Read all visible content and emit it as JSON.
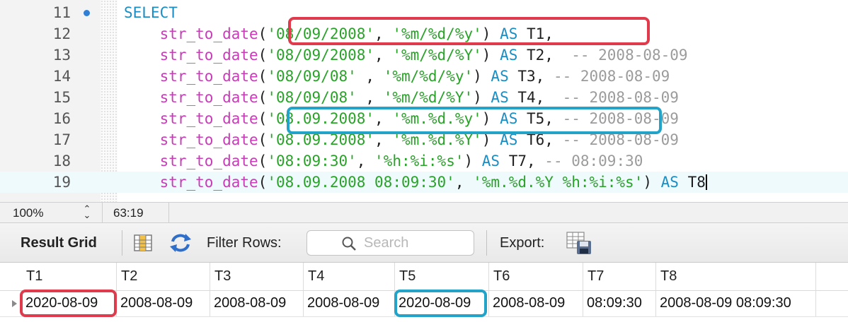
{
  "editor": {
    "lines": [
      {
        "num": "11",
        "breakpoint": true,
        "current": false,
        "tokens": [
          {
            "t": "SELECT",
            "c": "kw"
          }
        ]
      },
      {
        "num": "12",
        "current": false,
        "tokens": [
          {
            "t": "    str_to_date",
            "c": "fn"
          },
          {
            "t": "(",
            "c": "pn"
          },
          {
            "t": "'08/09/2008'",
            "c": "str"
          },
          {
            "t": ", ",
            "c": "pn"
          },
          {
            "t": "'%m/%d/%y'",
            "c": "str"
          },
          {
            "t": ") ",
            "c": "pn"
          },
          {
            "t": "AS",
            "c": "kw"
          },
          {
            "t": " T1,",
            "c": "id"
          }
        ]
      },
      {
        "num": "13",
        "current": false,
        "tokens": [
          {
            "t": "    str_to_date",
            "c": "fn"
          },
          {
            "t": "(",
            "c": "pn"
          },
          {
            "t": "'08/09/2008'",
            "c": "str"
          },
          {
            "t": ", ",
            "c": "pn"
          },
          {
            "t": "'%m/%d/%Y'",
            "c": "str"
          },
          {
            "t": ") ",
            "c": "pn"
          },
          {
            "t": "AS",
            "c": "kw"
          },
          {
            "t": " T2,  ",
            "c": "id"
          },
          {
            "t": "-- 2008-08-09",
            "c": "cm"
          }
        ]
      },
      {
        "num": "14",
        "current": false,
        "tokens": [
          {
            "t": "    str_to_date",
            "c": "fn"
          },
          {
            "t": "(",
            "c": "pn"
          },
          {
            "t": "'08/09/08'",
            "c": "str"
          },
          {
            "t": " , ",
            "c": "pn"
          },
          {
            "t": "'%m/%d/%y'",
            "c": "str"
          },
          {
            "t": ") ",
            "c": "pn"
          },
          {
            "t": "AS",
            "c": "kw"
          },
          {
            "t": " T3, ",
            "c": "id"
          },
          {
            "t": "-- 2008-08-09",
            "c": "cm"
          }
        ]
      },
      {
        "num": "15",
        "current": false,
        "tokens": [
          {
            "t": "    str_to_date",
            "c": "fn"
          },
          {
            "t": "(",
            "c": "pn"
          },
          {
            "t": "'08/09/08'",
            "c": "str"
          },
          {
            "t": " , ",
            "c": "pn"
          },
          {
            "t": "'%m/%d/%Y'",
            "c": "str"
          },
          {
            "t": ") ",
            "c": "pn"
          },
          {
            "t": "AS",
            "c": "kw"
          },
          {
            "t": " T4,  ",
            "c": "id"
          },
          {
            "t": "-- 2008-08-09",
            "c": "cm"
          }
        ]
      },
      {
        "num": "16",
        "current": false,
        "tokens": [
          {
            "t": "    str_to_date",
            "c": "fn"
          },
          {
            "t": "(",
            "c": "pn"
          },
          {
            "t": "'08.09.2008'",
            "c": "str"
          },
          {
            "t": ", ",
            "c": "pn"
          },
          {
            "t": "'%m.%d.%y'",
            "c": "str"
          },
          {
            "t": ") ",
            "c": "pn"
          },
          {
            "t": "AS",
            "c": "kw"
          },
          {
            "t": " T5, ",
            "c": "id"
          },
          {
            "t": "-- 2008-08-09",
            "c": "cm"
          }
        ]
      },
      {
        "num": "17",
        "current": false,
        "tokens": [
          {
            "t": "    str_to_date",
            "c": "fn"
          },
          {
            "t": "(",
            "c": "pn"
          },
          {
            "t": "'08.09.2008'",
            "c": "str"
          },
          {
            "t": ", ",
            "c": "pn"
          },
          {
            "t": "'%m.%d.%Y'",
            "c": "str"
          },
          {
            "t": ") ",
            "c": "pn"
          },
          {
            "t": "AS",
            "c": "kw"
          },
          {
            "t": " T6, ",
            "c": "id"
          },
          {
            "t": "-- 2008-08-09",
            "c": "cm"
          }
        ]
      },
      {
        "num": "18",
        "current": false,
        "tokens": [
          {
            "t": "    str_to_date",
            "c": "fn"
          },
          {
            "t": "(",
            "c": "pn"
          },
          {
            "t": "'08:09:30'",
            "c": "str"
          },
          {
            "t": ", ",
            "c": "pn"
          },
          {
            "t": "'%h:%i:%s'",
            "c": "str"
          },
          {
            "t": ") ",
            "c": "pn"
          },
          {
            "t": "AS",
            "c": "kw"
          },
          {
            "t": " T7, ",
            "c": "id"
          },
          {
            "t": "-- 08:09:30",
            "c": "cm"
          }
        ]
      },
      {
        "num": "19",
        "current": true,
        "tokens": [
          {
            "t": "    str_to_date",
            "c": "fn"
          },
          {
            "t": "(",
            "c": "pn"
          },
          {
            "t": "'08.09.2008 08:09:30'",
            "c": "str"
          },
          {
            "t": ", ",
            "c": "pn"
          },
          {
            "t": "'%m.%d.%Y %h:%i:%s'",
            "c": "str"
          },
          {
            "t": ") ",
            "c": "pn"
          },
          {
            "t": "AS",
            "c": "kw"
          },
          {
            "t": " T8",
            "c": "id"
          }
        ]
      }
    ],
    "colors": {
      "keyword": "#1a8ec4",
      "function": "#c83cb8",
      "string": "#2aa22a",
      "comment": "#9b9b9b",
      "highlight_red": "#e03b4c",
      "highlight_blue": "#24a3c9"
    }
  },
  "status": {
    "zoom": "100%",
    "cursor": "63:19"
  },
  "toolbar": {
    "result_grid_label": "Result Grid",
    "filter_rows_label": "Filter Rows:",
    "search_placeholder": "Search",
    "export_label": "Export:"
  },
  "grid": {
    "columns": [
      "T1",
      "T2",
      "T3",
      "T4",
      "T5",
      "T6",
      "T7",
      "T8"
    ],
    "rows": [
      [
        "2020-08-09",
        "2008-08-09",
        "2008-08-09",
        "2008-08-09",
        "2020-08-09",
        "2008-08-09",
        "08:09:30",
        "2008-08-09 08:09:30"
      ]
    ]
  }
}
